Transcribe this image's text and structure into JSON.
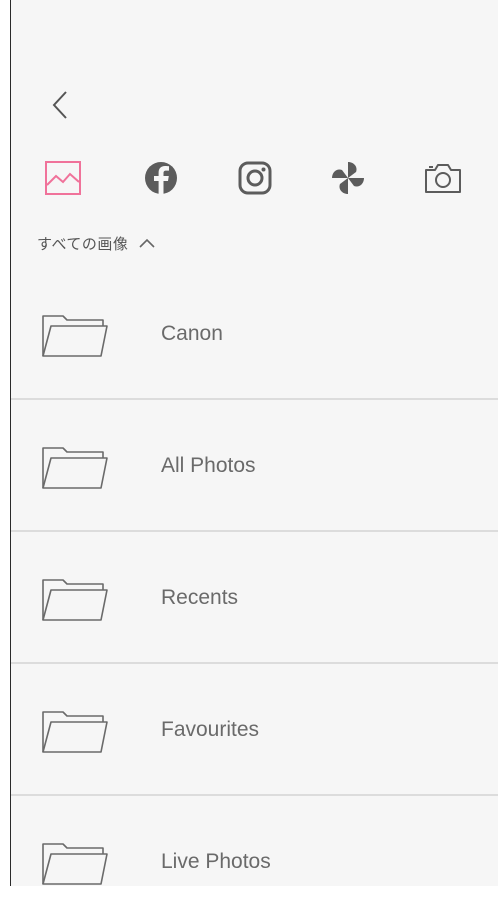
{
  "sources": [
    {
      "name": "gallery",
      "icon": "image-icon",
      "active": true,
      "color": "#f0729a"
    },
    {
      "name": "facebook",
      "icon": "facebook-icon",
      "active": false,
      "color": "#5c5c5c"
    },
    {
      "name": "instagram",
      "icon": "instagram-icon",
      "active": false,
      "color": "#5c5c5c"
    },
    {
      "name": "pinwheel",
      "icon": "pinwheel-icon",
      "active": false,
      "color": "#5c5c5c"
    },
    {
      "name": "camera",
      "icon": "camera-icon",
      "active": false,
      "color": "#5c5c5c"
    }
  ],
  "album_selector": {
    "title": "すべての画像",
    "icon": "chevron-up-icon"
  },
  "folders": [
    {
      "label": "Canon"
    },
    {
      "label": "All Photos"
    },
    {
      "label": "Recents"
    },
    {
      "label": "Favourites"
    },
    {
      "label": "Live Photos"
    }
  ]
}
